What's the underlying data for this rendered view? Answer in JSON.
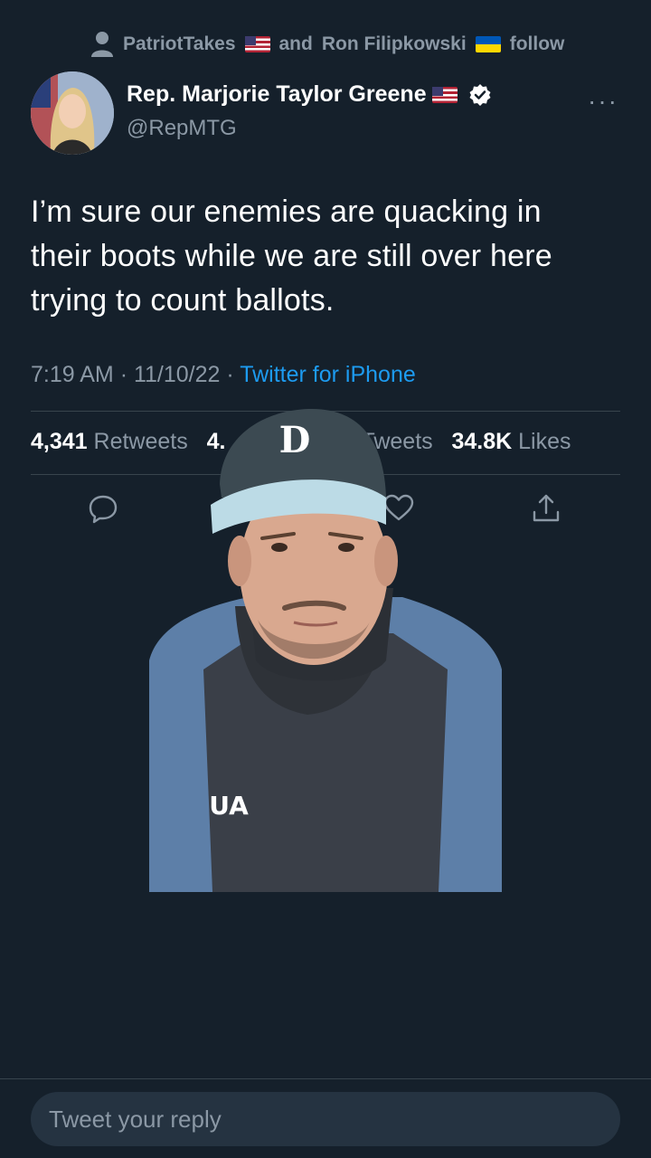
{
  "social_context": {
    "icon": "person-icon",
    "user1": "PatriotTakes",
    "connector": "and",
    "user2": "Ron Filipkowski",
    "action": "follow"
  },
  "tweet": {
    "author_name": "Rep. Marjorie Taylor Greene",
    "handle": "@RepMTG",
    "text": "I’m sure our enemies are quacking in their boots while we are still over here trying to count ballots.",
    "time": "7:19 AM",
    "date": "11/10/22",
    "source": "Twitter for iPhone",
    "retweets_count": "4,341",
    "retweets_label": "Retweets",
    "quote_count_partial": "4.",
    "quote_label_partial": "Tweets",
    "likes_count": "34.8K",
    "likes_label": "Likes"
  },
  "actions": [
    "reply-icon",
    "retweet-icon",
    "like-icon",
    "share-icon"
  ],
  "video_overlay": {
    "cap_logo": "D",
    "shirt_logo": "UA"
  },
  "reply": {
    "placeholder": "Tweet your reply"
  },
  "colors": {
    "background": "#15202b",
    "muted": "#8b98a5",
    "link": "#1d9bf0",
    "divider": "#38444d"
  }
}
